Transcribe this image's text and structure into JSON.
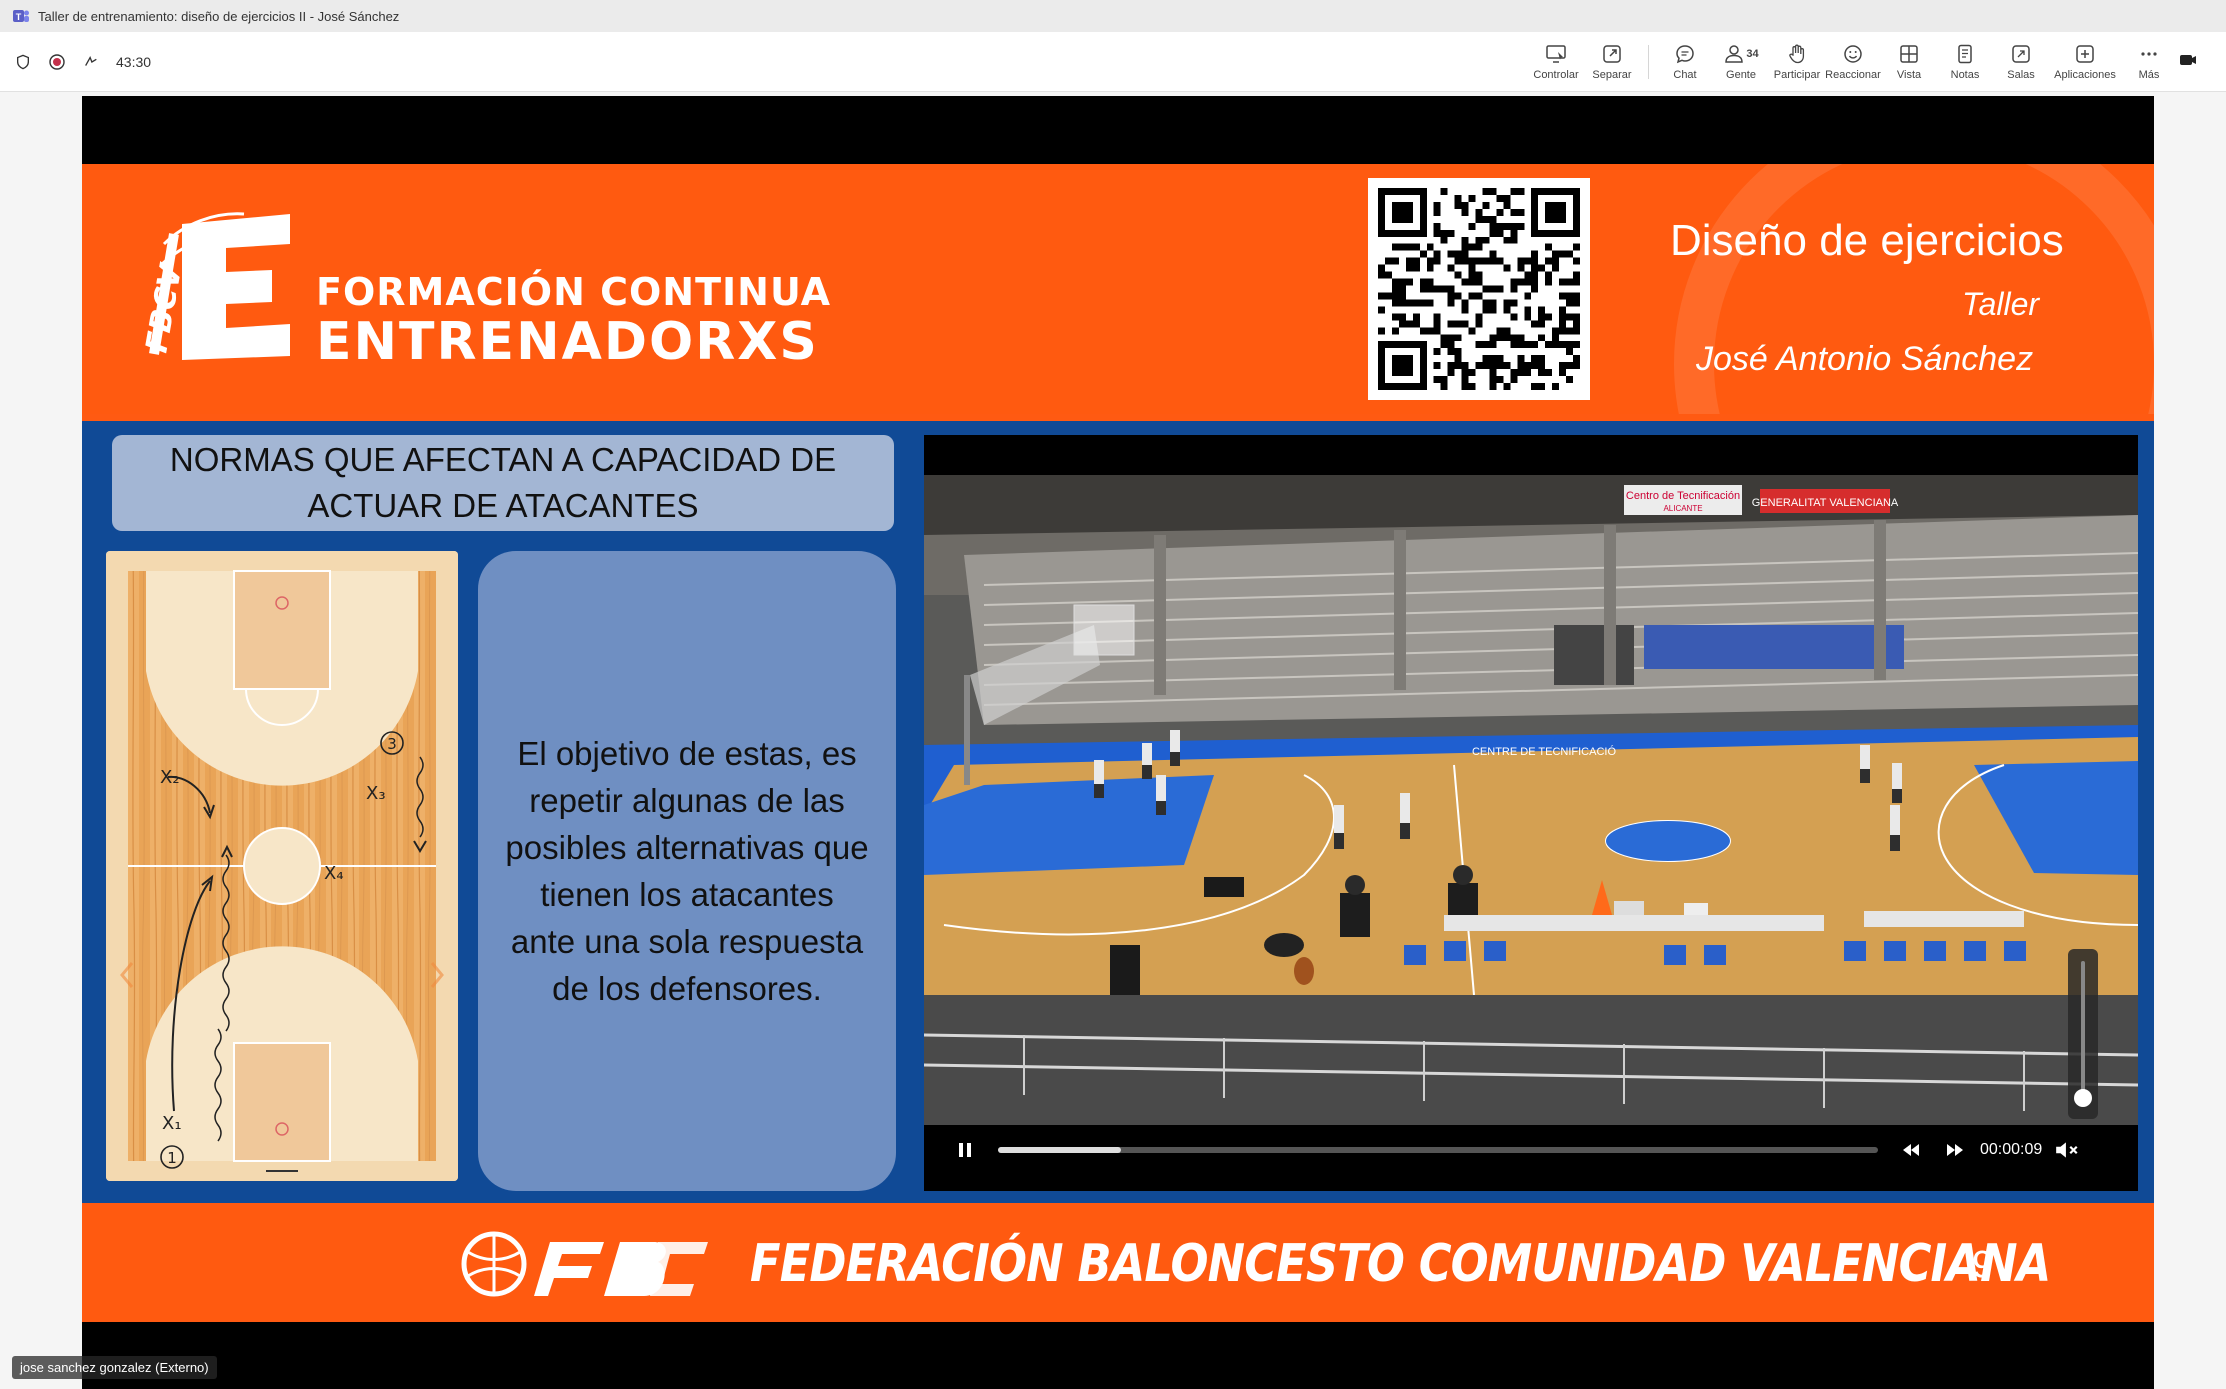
{
  "window": {
    "title": "Taller de entrenamiento: diseño de ejercicios II - José Sánchez"
  },
  "toolbar": {
    "timer": "43:30",
    "buttons": [
      {
        "label": "Controlar",
        "icon": "control-icon"
      },
      {
        "label": "Separar",
        "icon": "pop-out-icon"
      },
      {
        "label": "Chat",
        "icon": "chat-icon"
      },
      {
        "label": "Gente",
        "icon": "people-icon",
        "count": "34"
      },
      {
        "label": "Participar",
        "icon": "raise-hand-icon"
      },
      {
        "label": "Reaccionar",
        "icon": "react-icon"
      },
      {
        "label": "Vista",
        "icon": "view-icon"
      },
      {
        "label": "Notas",
        "icon": "notes-icon"
      },
      {
        "label": "Salas",
        "icon": "rooms-icon"
      },
      {
        "label": "Aplicaciones",
        "icon": "apps-icon"
      },
      {
        "label": "Más",
        "icon": "more-icon"
      }
    ]
  },
  "slide": {
    "header": {
      "logo_line1": "FORMACIÓN CONTINUA",
      "logo_line2": "ENTRENADORXS",
      "title": "Diseño de ejercicios",
      "subtitle": "Taller",
      "author": "José Antonio Sánchez"
    },
    "heading": "NORMAS QUE AFECTAN A CAPACIDAD DE ACTUAR DE ATACANTES",
    "body_text": "El objetivo de estas, es repetir algunas de las posibles alternativas que tienen los atacantes ante una sola respuesta de los defensores.",
    "diagram_labels": {
      "x1": "X₁",
      "x2": "X₂",
      "x3": "X₃",
      "x4": "X₄",
      "p1": "1",
      "p3": "3"
    },
    "video": {
      "time": "00:00:09",
      "progress_fraction": 0.14,
      "volume_fraction": 0.0,
      "banner_left": "Centro de Tecnificación",
      "banner_left_sub": "ALICANTE",
      "banner_right": "GENERALITAT VALENCIANA",
      "court_text": "CENTRE DE TECNIFICACIÓ"
    },
    "footer": {
      "org": "FEDERACIÓN BALONCESTO COMUNIDAD VALENCIANA",
      "page_number": "9"
    }
  },
  "participant_label": "jose sanchez gonzalez (Externo)",
  "colors": {
    "orange": "#ff5a10",
    "blue": "#104a96",
    "teams_purple": "#5b5fc7"
  }
}
